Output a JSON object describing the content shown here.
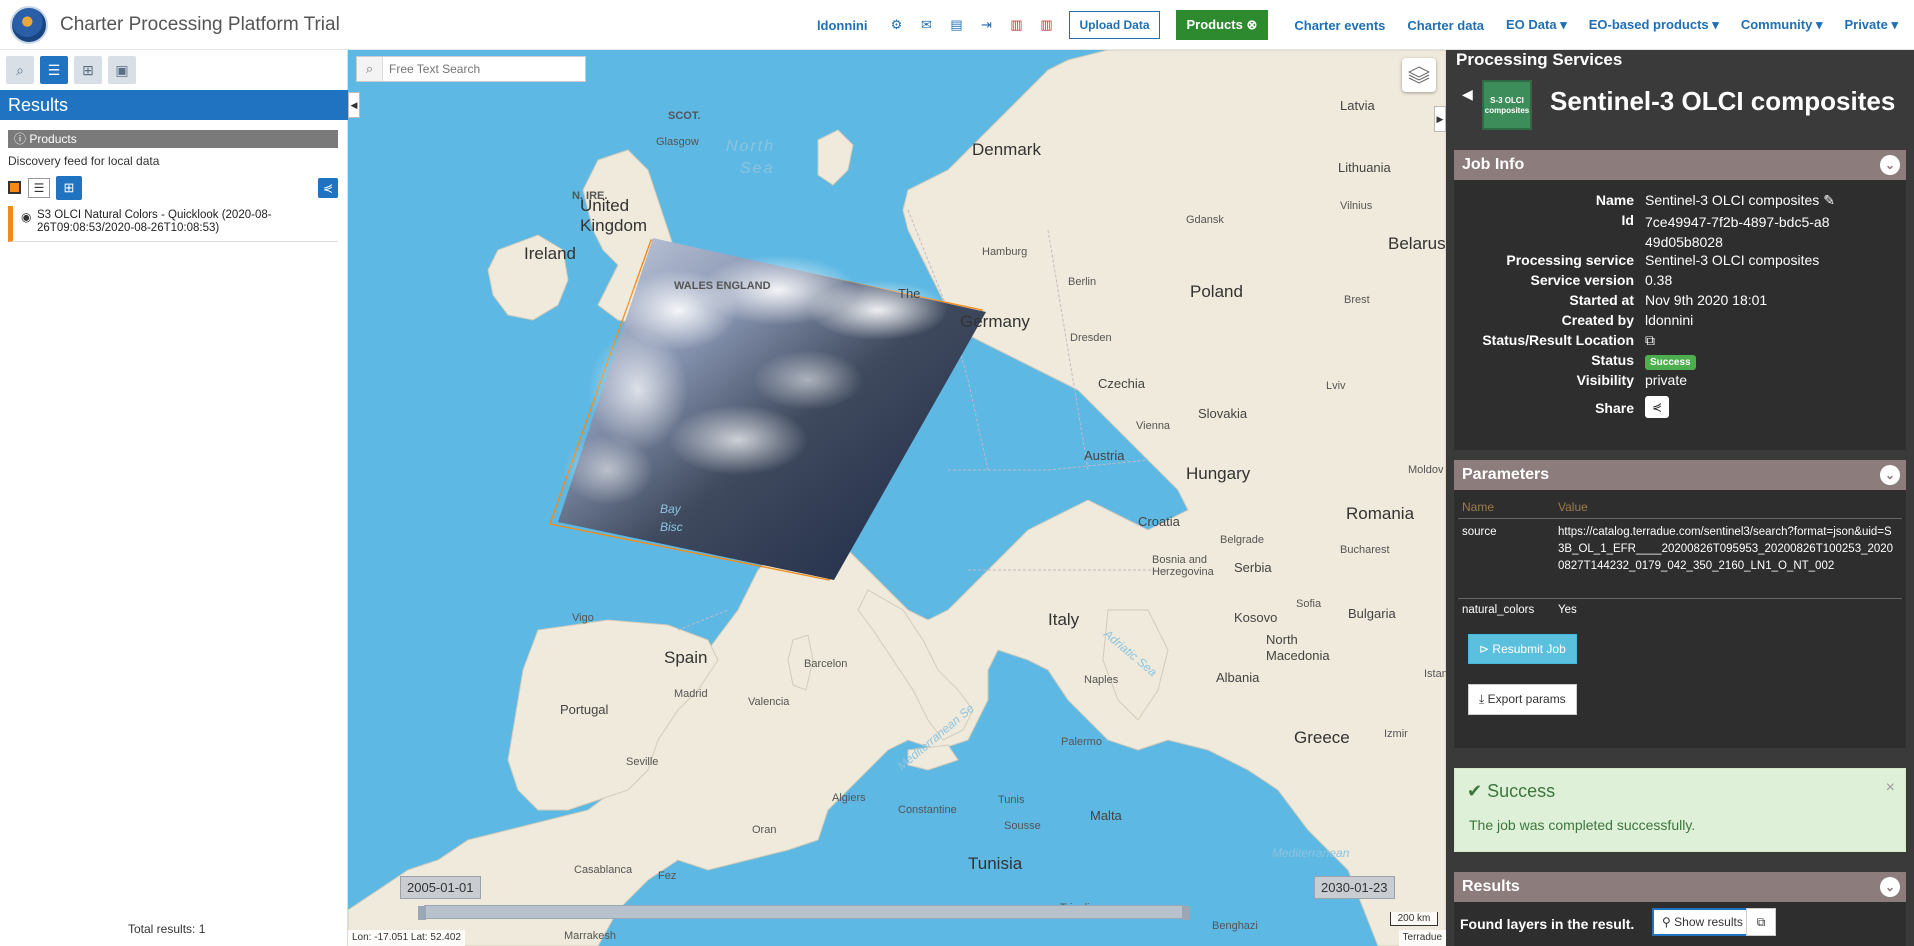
{
  "header": {
    "app_title": "Charter Processing Platform Trial",
    "user": "ldonnini",
    "upload_label": "Upload Data",
    "products_label": "Products",
    "nav_links": [
      "Charter events",
      "Charter data",
      "EO Data",
      "EO-based products",
      "Community",
      "Private"
    ]
  },
  "left": {
    "results_title": "Results",
    "products_label": "Products",
    "feed_description": "Discovery feed for local data",
    "item_title": "S3 OLCI Natural Colors - Quicklook (2020-08-26T09:08:53/2020-08-26T10:08:53)",
    "total_results": "Total results: 1"
  },
  "map": {
    "search_placeholder": "Free Text Search",
    "labels": {
      "north_sea": "North Sea",
      "denmark": "Denmark",
      "united_kingdom": "United Kingdom",
      "ireland": "Ireland",
      "scot": "SCOT.",
      "n_ire": "N. IRE.",
      "glasgow": "Glasgow",
      "wales_england": "WALES ENGLAND",
      "the": "The",
      "germany": "Germany",
      "poland": "Poland",
      "belarus": "Belarus",
      "latvia": "Latvia",
      "lithuania": "Lithuania",
      "vilnius": "Vilnius",
      "gdansk": "Gdansk",
      "hamburg": "Hamburg",
      "berlin": "Berlin",
      "dresden": "Dresden",
      "brest": "Brest",
      "lviv": "Lviv",
      "czechia": "Czechia",
      "slovakia": "Slovakia",
      "vienna": "Vienna",
      "austria": "Austria",
      "hungary": "Hungary",
      "moldova": "Moldov",
      "romania": "Romania",
      "croatia": "Croatia",
      "belgrade": "Belgrade",
      "bucharest": "Bucharest",
      "bosnia": "Bosnia and Herzegovina",
      "serbia": "Serbia",
      "sofia": "Sofia",
      "bulgaria": "Bulgaria",
      "kosovo": "Kosovo",
      "north_macedonia": "North Macedonia",
      "albania": "Albania",
      "istanbul": "Istanb",
      "italy": "Italy",
      "adriatic": "Adriatic Sea",
      "naples": "Naples",
      "palermo": "Palermo",
      "malta": "Malta",
      "greece": "Greece",
      "izmir": "Izmir",
      "bay": "Bay",
      "bisc": "Bisc",
      "spain": "Spain",
      "barcelona": "Barcelon",
      "vigo": "Vigo",
      "madrid": "Madrid",
      "valencia": "Valencia",
      "portugal": "Portugal",
      "seville": "Seville",
      "mediterranean": "Mediterranean Se",
      "algiers": "Algiers",
      "constantine": "Constantine",
      "tunis": "Tunis",
      "sousse": "Sousse",
      "tunisia": "Tunisia",
      "oran": "Oran",
      "casablanca": "Casablanca",
      "fez": "Fez",
      "marrakesh": "Marrakesh",
      "tripoli": "Tripoli",
      "benghazi": "Benghazi",
      "mediterranean_east": "Mediterranean"
    },
    "timeline_start": "2005-01-01",
    "timeline_end": "2030-01-23",
    "scale": "200 km",
    "coords": "Lon: -17.051  Lat: 52.402",
    "attribution": "Terradue"
  },
  "right": {
    "panel_title": "Processing Services",
    "service_icon_text": "S-3 OLCI composites",
    "service_name": "Sentinel-3 OLCI composites",
    "job_info": {
      "title": "Job Info",
      "rows": [
        {
          "key": "Name",
          "value": "Sentinel-3 OLCI composites ✎"
        },
        {
          "key": "Id",
          "value": "7ce49947-7f2b-4897-bdc5-a849d05b8028"
        },
        {
          "key": "Processing service",
          "value": "Sentinel-3 OLCI composites"
        },
        {
          "key": "Service version",
          "value": "0.38"
        },
        {
          "key": "Started at",
          "value": "Nov 9th 2020 18:01"
        },
        {
          "key": "Created by",
          "value": "ldonnini"
        },
        {
          "key": "Status/Result Location",
          "value": "⧉"
        },
        {
          "key": "Status",
          "value": "Success"
        },
        {
          "key": "Visibility",
          "value": "private"
        },
        {
          "key": "Share",
          "value": ""
        }
      ]
    },
    "parameters": {
      "title": "Parameters",
      "col_name": "Name",
      "col_value": "Value",
      "rows": [
        {
          "name": "source",
          "value": "https://catalog.terradue.com/sentinel3/search?format=json&uid=S3B_OL_1_EFR____20200826T095953_20200826T100253_20200827T144232_0179_042_350_2160_LN1_O_NT_002"
        },
        {
          "name": "natural_colors",
          "value": "Yes"
        }
      ],
      "resubmit_label": "Resubmit Job",
      "export_label": "Export params"
    },
    "alert": {
      "title": "Success",
      "message": "The job was completed successfully."
    },
    "results": {
      "title": "Results",
      "found_text": "Found layers in the result.",
      "show_label": "Show results"
    }
  }
}
